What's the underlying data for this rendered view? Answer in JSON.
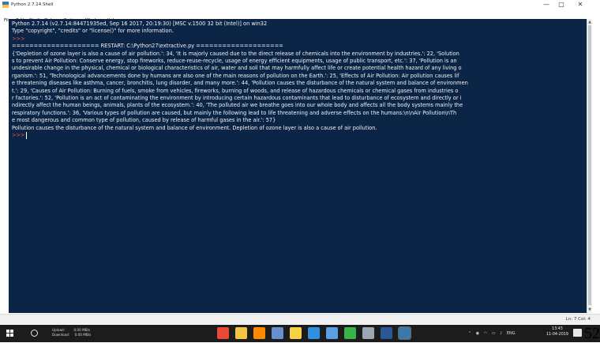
{
  "window": {
    "title": "Python 2.7.14 Shell",
    "controls": {
      "minimize": "—",
      "maximize": "□",
      "close": "✕"
    }
  },
  "menu": [
    "File",
    "Edit",
    "Shell",
    "Debug",
    "Options",
    "Window",
    "Help"
  ],
  "shell": {
    "lines": [
      {
        "text": "Python 2.7.14 (v2.7.14:84471935ed, Sep 16 2017, 20:19:30) [MSC v.1500 32 bit (Intel)] on win32",
        "color": "w"
      },
      {
        "text": "Type \"copyright\", \"credits\" or \"license()\" for more information.",
        "color": "w"
      },
      {
        "text": ">>>",
        "color": "r"
      },
      {
        "text": "==================== RESTART: C:\\Python27\\extractive.py ====================",
        "color": "w"
      },
      {
        "text": "{'Depletion of ozone layer is also a cause of air pollution.': 34, 'It is majorly caused due to the direct release of chemicals into the environment by industries.': 22, 'Solution",
        "color": "w"
      },
      {
        "text": "s to prevent Air Pollution: Conserve energy, stop fireworks, reduce-reuse-recycle, usage of energy efficient equipments, usage of public transport, etc.': 37, 'Pollution is an",
        "color": "w"
      },
      {
        "text": "undesirable change in the physical, chemical or biological characteristics of air, water and soil that may harmfully affect life or create potential health hazard of any living o",
        "color": "w"
      },
      {
        "text": "rganism.': 51, 'Technological advancements done by humans are also one of the main reasons of pollution on the Earth.': 25, 'Effects of Air Pollution: Air pollution causes lif",
        "color": "w"
      },
      {
        "text": "e threatening diseases like asthma, cancer, bronchitis, lung disorder, and many more.': 44, 'Pollution causes the disturbance of the natural system and balance of environmen",
        "color": "w"
      },
      {
        "text": "t.': 29, 'Causes of Air Pollution: Burning of fuels, smoke from vehicles, fireworks, burning of woods, and release of hazardous chemicals or chemical gases from industries o",
        "color": "w"
      },
      {
        "text": "r factories.': 52, 'Pollution is an act of contaminating the environment by introducing certain hazardous contaminants that lead to disturbance of ecosystem and directly or i",
        "color": "w"
      },
      {
        "text": "ndirectly affect the human beings, animals, plants of the ecosystem.': 40, 'The polluted air we breathe goes into our whole body and affects all the body systems mainly the",
        "color": "w"
      },
      {
        "text": "respiratory functions.': 36, 'Various types of pollution are caused, but mainly the following lead to life threatening and adverse effects on the humans:\\n\\nAir Pollution\\nTh",
        "color": "w"
      },
      {
        "text": "e most dangerous and common type of pollution, caused by release of harmful gases in the air.': 57}",
        "color": "w"
      },
      {
        "text": " Pollution causes the disturbance of the natural system and balance of environment. Depletion of ozone layer is also a cause of air pollution.",
        "color": "w"
      },
      {
        "text": ">>>",
        "color": "r",
        "cursor": true
      }
    ]
  },
  "statusbar": {
    "position": "Ln: 7  Col: 4"
  },
  "taskbar": {
    "network": {
      "upload_label": "Upload:",
      "upload_value": "0.00 MB/s",
      "download_label": "Download:",
      "download_value": "0.00 MB/s"
    },
    "apps": [
      {
        "name": "chrome-icon",
        "color": "#e94a35"
      },
      {
        "name": "file-explorer-icon",
        "color": "#f4c542"
      },
      {
        "name": "firefox-icon",
        "color": "#ff8a00"
      },
      {
        "name": "people-icon",
        "color": "#6a8fcf"
      },
      {
        "name": "notes-icon",
        "color": "#f6d046"
      },
      {
        "name": "store-icon",
        "color": "#2f8fe0"
      },
      {
        "name": "photos-icon",
        "color": "#5aa0e6"
      },
      {
        "name": "music-icon",
        "color": "#37b34a"
      },
      {
        "name": "settings-icon",
        "color": "#9aa7b5"
      },
      {
        "name": "word-icon",
        "color": "#2b5797"
      },
      {
        "name": "python-idle-icon",
        "color": "#3c78aa",
        "active": true
      }
    ],
    "tray": {
      "language": "ENG",
      "time": "13:43",
      "date": "11-04-2019"
    }
  },
  "overlay_number": "520"
}
